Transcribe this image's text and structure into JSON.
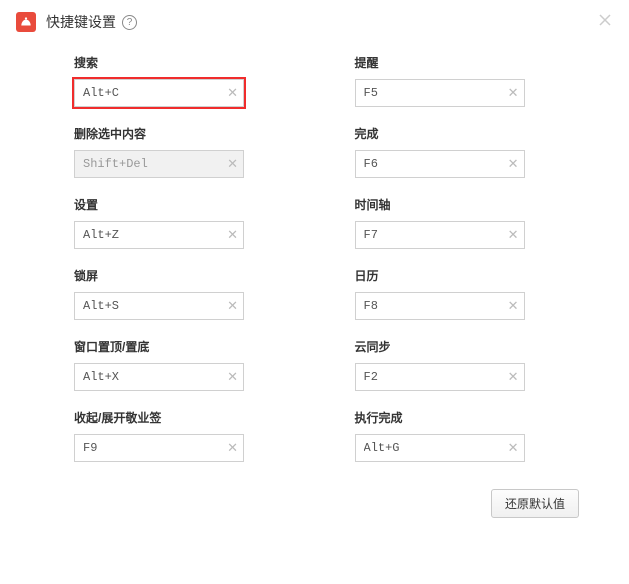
{
  "header": {
    "title": "快捷键设置"
  },
  "left": [
    {
      "label": "搜索",
      "value": "Alt+C",
      "highlighted": true,
      "disabled": false
    },
    {
      "label": "删除选中内容",
      "value": "Shift+Del",
      "highlighted": false,
      "disabled": true
    },
    {
      "label": "设置",
      "value": "Alt+Z",
      "highlighted": false,
      "disabled": false
    },
    {
      "label": "锁屏",
      "value": "Alt+S",
      "highlighted": false,
      "disabled": false
    },
    {
      "label": "窗口置顶/置底",
      "value": "Alt+X",
      "highlighted": false,
      "disabled": false
    },
    {
      "label": "收起/展开敬业签",
      "value": "F9",
      "highlighted": false,
      "disabled": false
    }
  ],
  "right": [
    {
      "label": "提醒",
      "value": "F5",
      "highlighted": false,
      "disabled": false
    },
    {
      "label": "完成",
      "value": "F6",
      "highlighted": false,
      "disabled": false
    },
    {
      "label": "时间轴",
      "value": "F7",
      "highlighted": false,
      "disabled": false
    },
    {
      "label": "日历",
      "value": "F8",
      "highlighted": false,
      "disabled": false
    },
    {
      "label": "云同步",
      "value": "F2",
      "highlighted": false,
      "disabled": false
    },
    {
      "label": "执行完成",
      "value": "Alt+G",
      "highlighted": false,
      "disabled": false
    }
  ],
  "footer": {
    "reset_label": "还原默认值"
  }
}
